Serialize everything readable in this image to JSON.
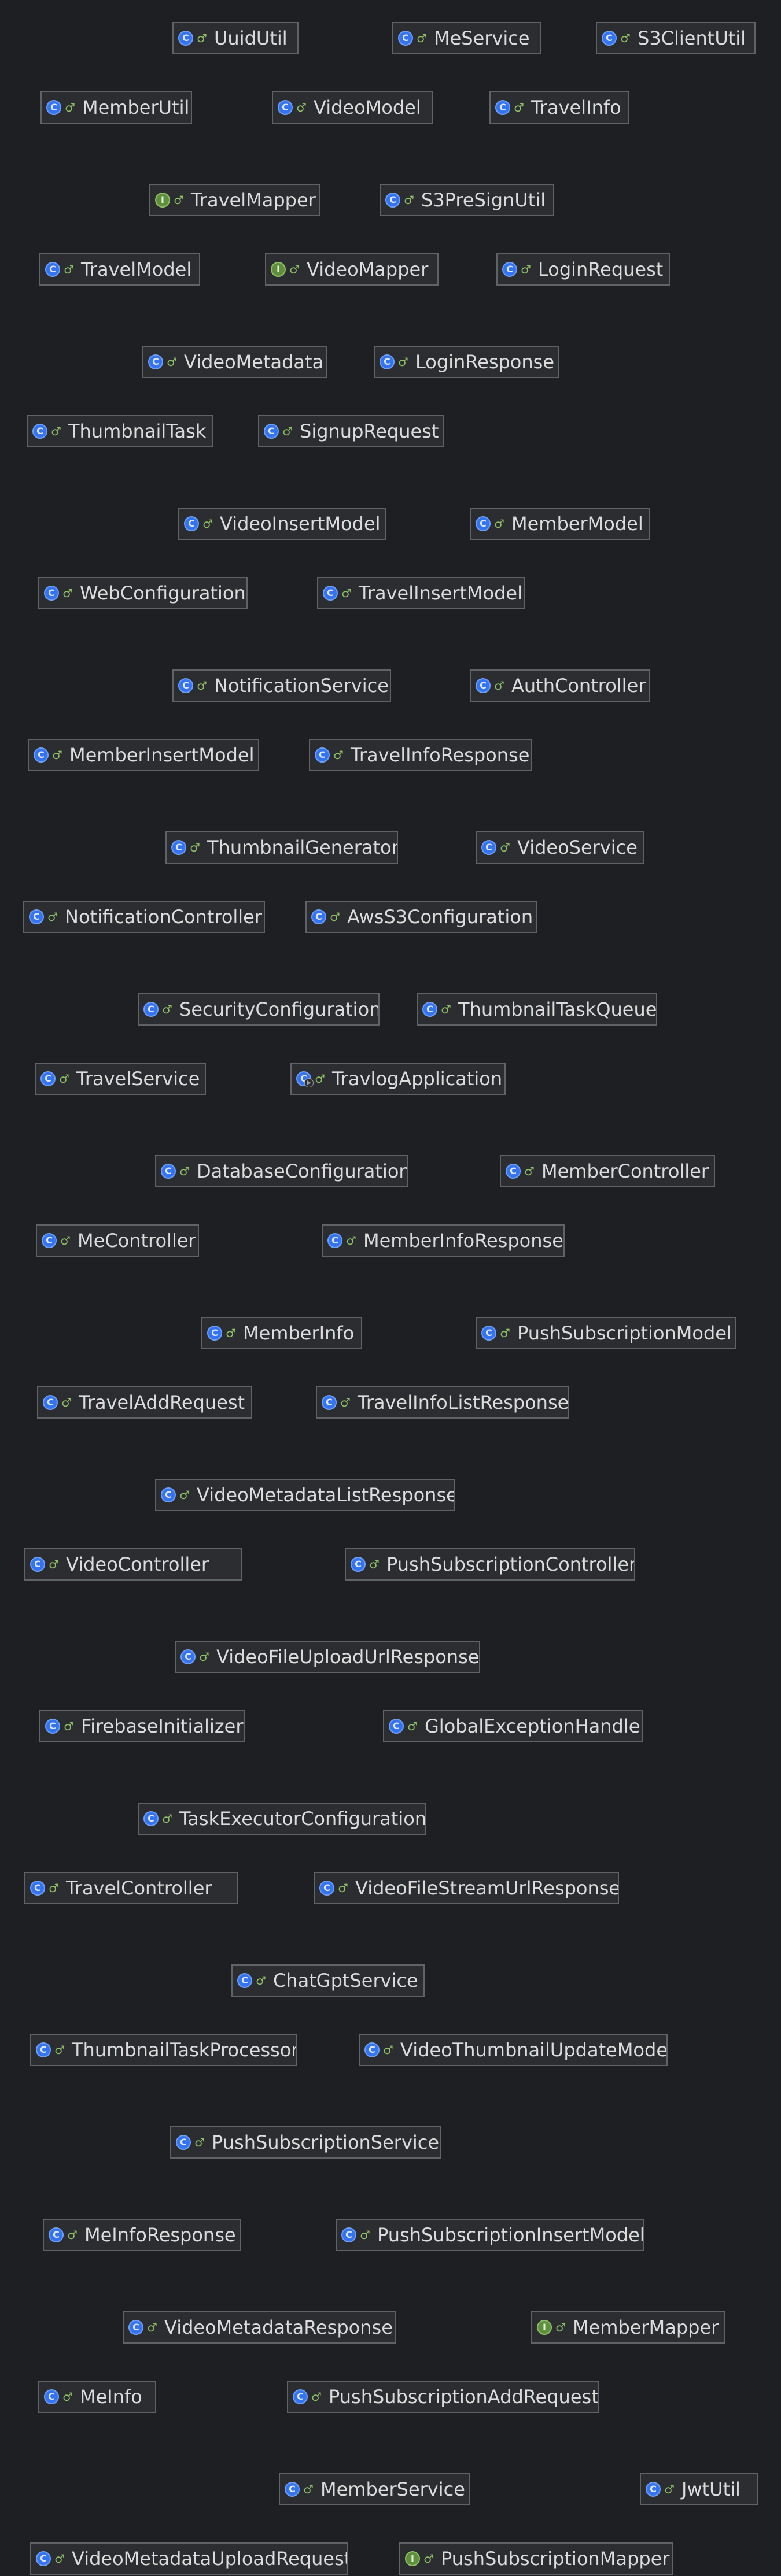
{
  "diagram": {
    "kind_glyphs": {
      "class": "C",
      "interface": "I",
      "application": "C"
    },
    "visibility_glyph": "♂",
    "colors": {
      "background": "#1e1f22",
      "node_fill": "#2b2d30",
      "node_border": "#5f6266",
      "text": "#dcdcdc",
      "class_icon": "#3574f0",
      "interface_icon": "#5f8f3c"
    },
    "nodes": [
      {
        "id": "uuid-util",
        "label": "UuidUtil",
        "kind": "class"
      },
      {
        "id": "me-service",
        "label": "MeService",
        "kind": "class"
      },
      {
        "id": "s3-client-util",
        "label": "S3ClientUtil",
        "kind": "class"
      },
      {
        "id": "member-util",
        "label": "MemberUtil",
        "kind": "class"
      },
      {
        "id": "video-model",
        "label": "VideoModel",
        "kind": "class"
      },
      {
        "id": "travel-info",
        "label": "TravelInfo",
        "kind": "class"
      },
      {
        "id": "travel-mapper",
        "label": "TravelMapper",
        "kind": "interface"
      },
      {
        "id": "s3-presign-util",
        "label": "S3PreSignUtil",
        "kind": "class"
      },
      {
        "id": "travel-model",
        "label": "TravelModel",
        "kind": "class"
      },
      {
        "id": "video-mapper",
        "label": "VideoMapper",
        "kind": "interface"
      },
      {
        "id": "login-request",
        "label": "LoginRequest",
        "kind": "class"
      },
      {
        "id": "video-metadata",
        "label": "VideoMetadata",
        "kind": "class"
      },
      {
        "id": "login-response",
        "label": "LoginResponse",
        "kind": "class"
      },
      {
        "id": "thumbnail-task",
        "label": "ThumbnailTask",
        "kind": "class"
      },
      {
        "id": "signup-request",
        "label": "SignupRequest",
        "kind": "class"
      },
      {
        "id": "video-insert-model",
        "label": "VideoInsertModel",
        "kind": "class"
      },
      {
        "id": "member-model",
        "label": "MemberModel",
        "kind": "class"
      },
      {
        "id": "web-configuration",
        "label": "WebConfiguration",
        "kind": "class"
      },
      {
        "id": "travel-insert-model",
        "label": "TravelInsertModel",
        "kind": "class"
      },
      {
        "id": "notification-service",
        "label": "NotificationService",
        "kind": "class"
      },
      {
        "id": "auth-controller",
        "label": "AuthController",
        "kind": "class"
      },
      {
        "id": "member-insert-model",
        "label": "MemberInsertModel",
        "kind": "class"
      },
      {
        "id": "travel-info-response",
        "label": "TravelInfoResponse",
        "kind": "class"
      },
      {
        "id": "thumbnail-generator",
        "label": "ThumbnailGenerator",
        "kind": "class"
      },
      {
        "id": "video-service",
        "label": "VideoService",
        "kind": "class"
      },
      {
        "id": "notification-controller",
        "label": "NotificationController",
        "kind": "class"
      },
      {
        "id": "aws-s3-configuration",
        "label": "AwsS3Configuration",
        "kind": "class"
      },
      {
        "id": "security-configuration",
        "label": "SecurityConfiguration",
        "kind": "class"
      },
      {
        "id": "thumbnail-task-queue",
        "label": "ThumbnailTaskQueue",
        "kind": "class"
      },
      {
        "id": "travel-service",
        "label": "TravelService",
        "kind": "class"
      },
      {
        "id": "travlog-application",
        "label": "TravlogApplication",
        "kind": "application"
      },
      {
        "id": "database-configuration",
        "label": "DatabaseConfiguration",
        "kind": "class"
      },
      {
        "id": "member-controller",
        "label": "MemberController",
        "kind": "class"
      },
      {
        "id": "me-controller",
        "label": "MeController",
        "kind": "class"
      },
      {
        "id": "member-info-response",
        "label": "MemberInfoResponse",
        "kind": "class"
      },
      {
        "id": "member-info",
        "label": "MemberInfo",
        "kind": "class"
      },
      {
        "id": "push-subscription-model",
        "label": "PushSubscriptionModel",
        "kind": "class"
      },
      {
        "id": "travel-add-request",
        "label": "TravelAddRequest",
        "kind": "class"
      },
      {
        "id": "travel-info-list-response",
        "label": "TravelInfoListResponse",
        "kind": "class"
      },
      {
        "id": "video-metadata-list-response",
        "label": "VideoMetadataListResponse",
        "kind": "class"
      },
      {
        "id": "video-controller",
        "label": "VideoController",
        "kind": "class"
      },
      {
        "id": "push-subscription-controller",
        "label": "PushSubscriptionController",
        "kind": "class"
      },
      {
        "id": "video-file-upload-url-response",
        "label": "VideoFileUploadUrlResponse",
        "kind": "class"
      },
      {
        "id": "firebase-initializer",
        "label": "FirebaseInitializer",
        "kind": "class"
      },
      {
        "id": "global-exception-handler",
        "label": "GlobalExceptionHandler",
        "kind": "class"
      },
      {
        "id": "task-executor-configuration",
        "label": "TaskExecutorConfiguration",
        "kind": "class"
      },
      {
        "id": "travel-controller",
        "label": "TravelController",
        "kind": "class"
      },
      {
        "id": "video-file-stream-url-response",
        "label": "VideoFileStreamUrlResponse",
        "kind": "class"
      },
      {
        "id": "chat-gpt-service",
        "label": "ChatGptService",
        "kind": "class"
      },
      {
        "id": "thumbnail-task-processor",
        "label": "ThumbnailTaskProcessor",
        "kind": "class"
      },
      {
        "id": "video-thumbnail-update-model",
        "label": "VideoThumbnailUpdateModel",
        "kind": "class"
      },
      {
        "id": "push-subscription-service",
        "label": "PushSubscriptionService",
        "kind": "class"
      },
      {
        "id": "me-info-response",
        "label": "MeInfoResponse",
        "kind": "class"
      },
      {
        "id": "push-subscription-insert-model",
        "label": "PushSubscriptionInsertModel",
        "kind": "class"
      },
      {
        "id": "video-metadata-response",
        "label": "VideoMetadataResponse",
        "kind": "class"
      },
      {
        "id": "member-mapper",
        "label": "MemberMapper",
        "kind": "interface"
      },
      {
        "id": "me-info",
        "label": "MeInfo",
        "kind": "class"
      },
      {
        "id": "push-subscription-add-request",
        "label": "PushSubscriptionAddRequest",
        "kind": "class"
      },
      {
        "id": "member-service",
        "label": "MemberService",
        "kind": "class"
      },
      {
        "id": "jwt-util",
        "label": "JwtUtil",
        "kind": "class"
      },
      {
        "id": "video-metadata-upload-request",
        "label": "VideoMetadataUploadRequest",
        "kind": "class"
      },
      {
        "id": "push-subscription-mapper",
        "label": "PushSubscriptionMapper",
        "kind": "interface"
      }
    ]
  }
}
